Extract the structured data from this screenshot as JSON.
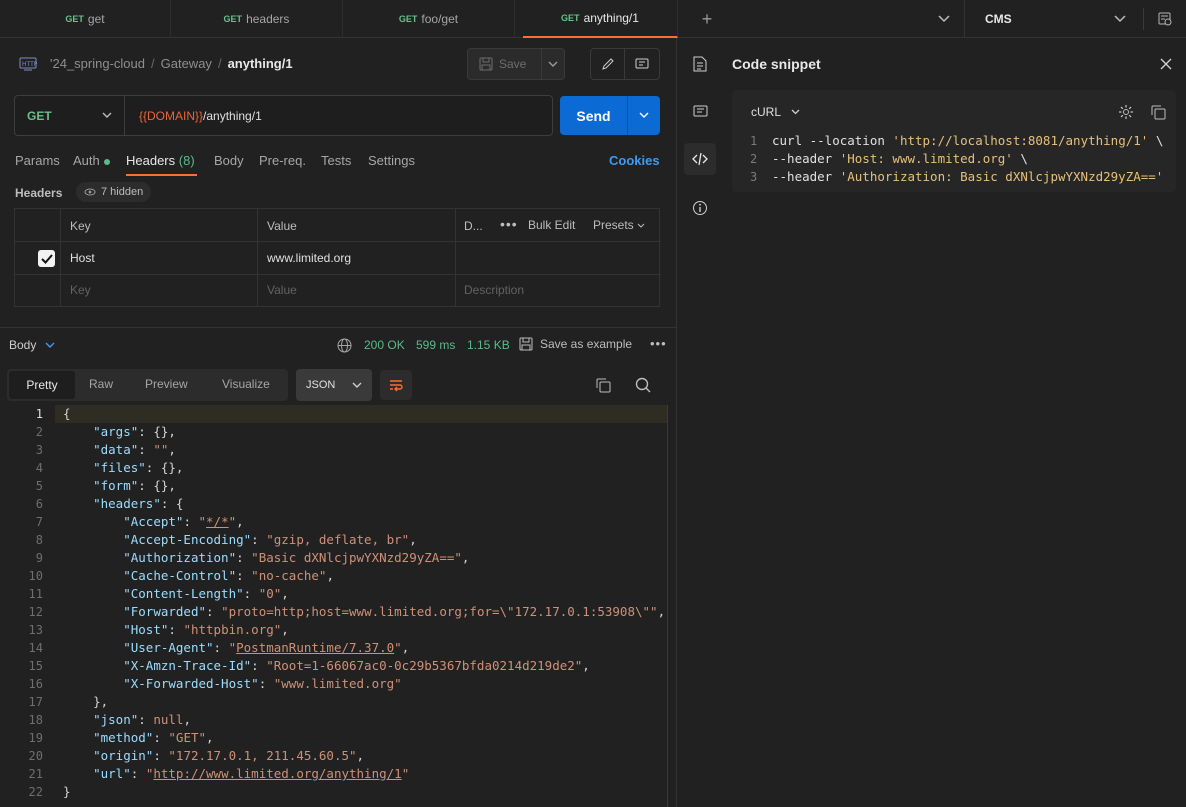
{
  "tabs": [
    {
      "method": "GET",
      "label": "get"
    },
    {
      "method": "GET",
      "label": "headers"
    },
    {
      "method": "GET",
      "label": "foo/get"
    },
    {
      "method": "GET",
      "label": "anything/1"
    }
  ],
  "environment": "CMS",
  "breadcrumb": {
    "collection": "'24_spring-cloud",
    "folder": "Gateway",
    "request": "anything/1"
  },
  "save_label": "Save",
  "request": {
    "method": "GET",
    "url_var": "{{DOMAIN}}",
    "url_path": "/anything/1",
    "send_label": "Send"
  },
  "request_tabs": {
    "params": "Params",
    "auth": "Auth",
    "headers": "Headers",
    "headers_count": "(8)",
    "body": "Body",
    "prereq": "Pre-req.",
    "tests": "Tests",
    "settings": "Settings",
    "cookies": "Cookies"
  },
  "headers_section": {
    "label": "Headers",
    "hidden": "7 hidden",
    "col_key": "Key",
    "col_value": "Value",
    "col_desc": "D...",
    "bulk_edit": "Bulk Edit",
    "presets": "Presets",
    "rows": [
      {
        "key": "Host",
        "value": "www.limited.org"
      }
    ],
    "placeholder_key": "Key",
    "placeholder_value": "Value",
    "placeholder_desc": "Description"
  },
  "response": {
    "label": "Body",
    "status": "200 OK",
    "time": "599 ms",
    "size": "1.15 KB",
    "save_example": "Save as example",
    "view_tabs": [
      "Pretty",
      "Raw",
      "Preview",
      "Visualize"
    ],
    "format": "JSON",
    "lines": [
      "{",
      "    \"args\": {},",
      "    \"data\": \"\",",
      "    \"files\": {},",
      "    \"form\": {},",
      "    \"headers\": {",
      "        \"Accept\": \"*/*\",",
      "        \"Accept-Encoding\": \"gzip, deflate, br\",",
      "        \"Authorization\": \"Basic dXNlcjpwYXNzd29yZA==\",",
      "        \"Cache-Control\": \"no-cache\",",
      "        \"Content-Length\": \"0\",",
      "        \"Forwarded\": \"proto=http;host=www.limited.org;for=\\\"172.17.0.1:53908\\\"\",",
      "        \"Host\": \"httpbin.org\",",
      "        \"User-Agent\": \"PostmanRuntime/7.37.0\",",
      "        \"X-Amzn-Trace-Id\": \"Root=1-66067ac0-0c29b5367bfda0214d219de2\",",
      "        \"X-Forwarded-Host\": \"www.limited.org\"",
      "    },",
      "    \"json\": null,",
      "    \"method\": \"GET\",",
      "    \"origin\": \"172.17.0.1, 211.45.60.5\",",
      "    \"url\": \"http://www.limited.org/anything/1\"",
      "}"
    ]
  },
  "code_snippet": {
    "title": "Code snippet",
    "language": "cURL",
    "lines": [
      "curl --location 'http://localhost:8081/anything/1' \\",
      "--header 'Host: www.limited.org' \\",
      "--header 'Authorization: Basic dXNlcjpwYXNzd29yZA=='"
    ]
  },
  "colors": {
    "accent": "#ff6c37",
    "send": "#0b6ad3",
    "status_ok": "#5cba8a",
    "method_get": "#6bbf8a"
  }
}
